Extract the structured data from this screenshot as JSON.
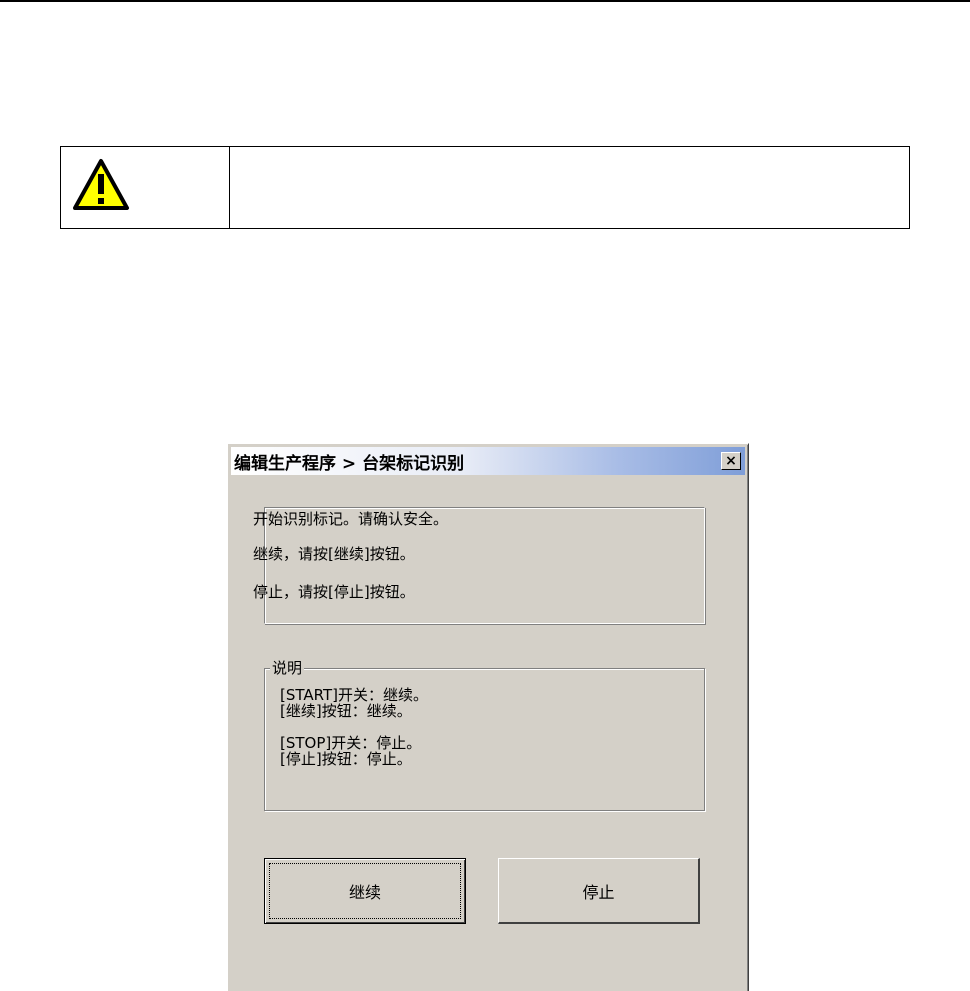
{
  "dialog": {
    "title": "编辑生产程序 > 台架标记识别",
    "close_label": "×",
    "messages": [
      "开始识别标记。请确认安全。",
      "继续，请按[继续]按钮。",
      "停止，请按[停止]按钮。"
    ],
    "group": {
      "title": "说明",
      "lines": "[START]开关：继续。\n[继续]按钮：继续。\n\n[STOP]开关：停止。\n[停止]按钮：停止。"
    },
    "buttons": {
      "continue": "继续",
      "stop": "停止"
    }
  },
  "icons": {
    "warning": "warning-icon"
  },
  "colors": {
    "dialog_bg": "#d4d0c8",
    "warning_fill": "#ffff00"
  }
}
